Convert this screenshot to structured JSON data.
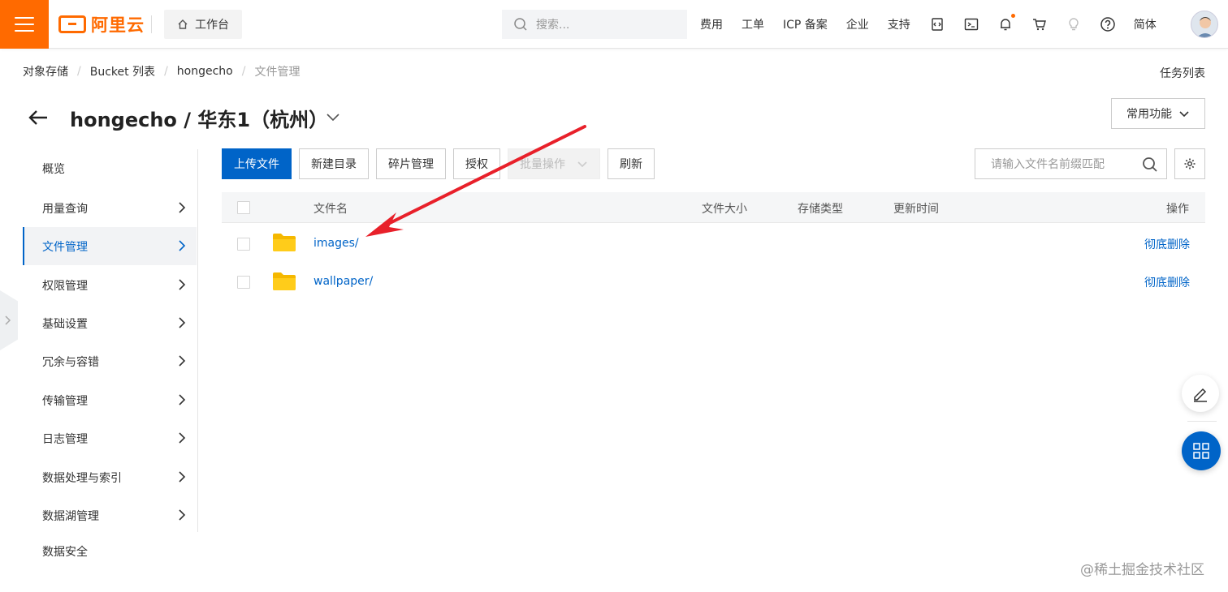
{
  "header": {
    "logo_text": "阿里云",
    "workbench_label": "工作台",
    "search_placeholder": "搜索...",
    "nav_links": [
      "费用",
      "工单",
      "ICP 备案",
      "企业",
      "支持"
    ],
    "language_label": "简体",
    "accent_color": "#ff6a00"
  },
  "breadcrumb": {
    "items": [
      "对象存储",
      "Bucket 列表",
      "hongecho",
      "文件管理"
    ],
    "task_list_label": "任务列表"
  },
  "title": {
    "text": "hongecho / 华东1（杭州）",
    "common_functions_label": "常用功能"
  },
  "sidebar": {
    "items": [
      {
        "label": "概览",
        "has_arrow": false
      },
      {
        "label": "用量查询",
        "has_arrow": true
      },
      {
        "label": "文件管理",
        "has_arrow": true,
        "active": true
      },
      {
        "label": "权限管理",
        "has_arrow": true
      },
      {
        "label": "基础设置",
        "has_arrow": true
      },
      {
        "label": "冗余与容错",
        "has_arrow": true
      },
      {
        "label": "传输管理",
        "has_arrow": true
      },
      {
        "label": "日志管理",
        "has_arrow": true
      },
      {
        "label": "数据处理与索引",
        "has_arrow": true
      },
      {
        "label": "数据湖管理",
        "has_arrow": true
      },
      {
        "label": "数据安全",
        "has_arrow": false
      }
    ],
    "active_color": "#0064c8"
  },
  "toolbar": {
    "upload_label": "上传文件",
    "new_dir_label": "新建目录",
    "fragment_label": "碎片管理",
    "authorize_label": "授权",
    "batch_label": "批量操作",
    "refresh_label": "刷新",
    "file_search_placeholder": "请输入文件名前缀匹配"
  },
  "table": {
    "headers": {
      "name": "文件名",
      "size": "文件大小",
      "storage": "存储类型",
      "updated": "更新时间",
      "actions": "操作"
    },
    "rows": [
      {
        "name": "images/",
        "action": "彻底删除"
      },
      {
        "name": "wallpaper/",
        "action": "彻底删除"
      }
    ]
  },
  "watermark": "@稀土掘金技术社区"
}
